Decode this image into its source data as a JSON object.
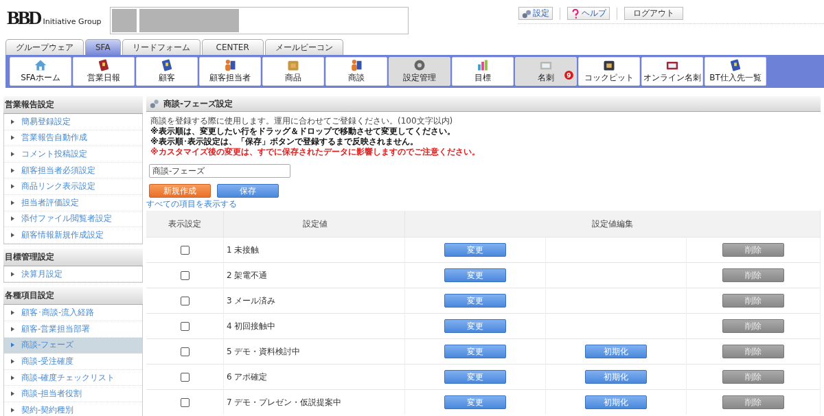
{
  "logo": {
    "mark": "BBD",
    "text": "Initiative Group"
  },
  "header_links": [
    {
      "label": "設定",
      "kind": "settings"
    },
    {
      "label": "ヘルプ",
      "kind": "help"
    },
    {
      "label": "ログアウト",
      "kind": "plain"
    }
  ],
  "tabs": [
    {
      "label": "グループウェア",
      "selected": false
    },
    {
      "label": "SFA",
      "selected": true
    },
    {
      "label": "リードフォーム",
      "selected": false
    },
    {
      "label": "CENTER",
      "selected": false
    },
    {
      "label": "メールビーコン",
      "selected": false
    }
  ],
  "nav": [
    {
      "label": "SFAホーム",
      "selected": false
    },
    {
      "label": "営業日報",
      "selected": false
    },
    {
      "label": "顧客",
      "selected": false
    },
    {
      "label": "顧客担当者",
      "selected": false
    },
    {
      "label": "商品",
      "selected": false
    },
    {
      "label": "商談",
      "selected": false
    },
    {
      "label": "設定管理",
      "selected": true
    },
    {
      "label": "目標",
      "selected": false
    },
    {
      "label": "名刺",
      "selected": true,
      "badge": "9"
    },
    {
      "label": "コックピット",
      "selected": false
    },
    {
      "label": "オンライン名刺",
      "selected": false
    },
    {
      "label": "BT仕入先一覧",
      "selected": false
    }
  ],
  "sidebar": [
    {
      "title": "営業報告設定",
      "items": [
        {
          "label": "簡易登録設定",
          "selected": false
        },
        {
          "label": "営業報告自動作成",
          "selected": false
        },
        {
          "label": "コメント投稿設定",
          "selected": false
        },
        {
          "label": "顧客担当者必須設定",
          "selected": false
        },
        {
          "label": "商品リンク表示設定",
          "selected": false
        },
        {
          "label": "担当者評価設定",
          "selected": false
        },
        {
          "label": "添付ファイル閲覧者設定",
          "selected": false
        },
        {
          "label": "顧客情報新規作成設定",
          "selected": false
        }
      ]
    },
    {
      "title": "目標管理設定",
      "items": [
        {
          "label": "決算月設定",
          "selected": false
        }
      ]
    },
    {
      "title": "各種項目設定",
      "items": [
        {
          "label": "顧客･商談-流入経路",
          "selected": false
        },
        {
          "label": "顧客-営業担当部署",
          "selected": false
        },
        {
          "label": "商談-フェーズ",
          "selected": true
        },
        {
          "label": "商談-受注確度",
          "selected": false
        },
        {
          "label": "商談-確度チェックリスト",
          "selected": false
        },
        {
          "label": "商談-担当者役割",
          "selected": false
        },
        {
          "label": "契約-契約種別",
          "selected": false
        }
      ]
    }
  ],
  "main": {
    "title": "商談-フェーズ設定",
    "notes": [
      {
        "text": "商談を登録する際に使用します。運用に合わせてご登録ください。(100文字以内)",
        "kind": "plain"
      },
      {
        "text": "※表示順は、変更したい行をドラッグ＆ドロップで移動させて変更してください。",
        "kind": "strong"
      },
      {
        "text": "※表示順･表示設定は、「保存」ボタンで登録するまで反映されません。",
        "kind": "strong"
      },
      {
        "text": "※カスタマイズ後の変更は、すでに保存されたデータに影響しますのでご注意ください。",
        "kind": "warning"
      }
    ],
    "name_field": {
      "value": "商談-フェーズ"
    },
    "new_button": "新規作成",
    "save_button": "保存",
    "show_all_link": "すべての項目を表示する",
    "table": {
      "columns": [
        "表示設定",
        "設定値",
        "設定値編集"
      ],
      "rows": [
        {
          "checked": false,
          "value": "1 未接触",
          "change": "変更",
          "delete": "削除",
          "delete_disabled": true
        },
        {
          "checked": false,
          "value": "2 架電不通",
          "change": "変更",
          "delete": "削除",
          "delete_disabled": true
        },
        {
          "checked": false,
          "value": "3 メール済み",
          "change": "変更",
          "delete": "削除",
          "delete_disabled": true
        },
        {
          "checked": false,
          "value": "4 初回接触中",
          "change": "変更",
          "delete": "削除",
          "delete_disabled": true
        },
        {
          "checked": false,
          "value": "5 デモ・資料検討中",
          "change": "変更",
          "reset": "初期化",
          "delete": "削除",
          "delete_disabled": true
        },
        {
          "checked": false,
          "value": "6 アポ確定",
          "change": "変更",
          "reset": "初期化",
          "delete": "削除",
          "delete_disabled": true
        },
        {
          "checked": false,
          "value": "7 デモ・プレゼン・仮説提案中",
          "change": "変更",
          "reset": "初期化",
          "delete": "削除",
          "delete_disabled": true
        }
      ]
    }
  }
}
